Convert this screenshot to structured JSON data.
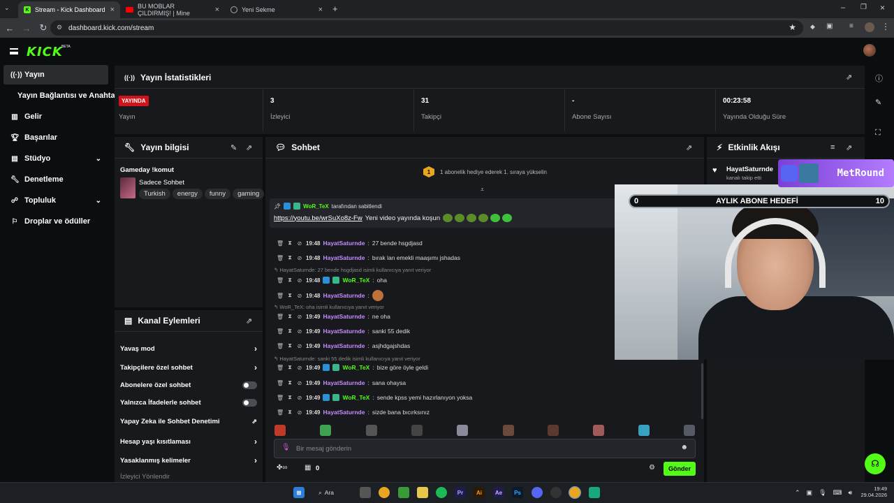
{
  "browser": {
    "tabs": [
      {
        "title": "Stream - Kick Dashboard"
      },
      {
        "title": "BU MOBLAR ÇILDIRMIŞ! | Mine"
      },
      {
        "title": "Yeni Sekme"
      }
    ],
    "url": "dashboard.kick.com/stream"
  },
  "header": {
    "logo": "KICK",
    "beta": "BETA"
  },
  "sidebar": {
    "items": [
      {
        "label": "Yayın"
      },
      {
        "label": "Yayın Bağlantısı ve Anahtarı"
      },
      {
        "label": "Gelir"
      },
      {
        "label": "Başarılar"
      },
      {
        "label": "Stüdyo"
      },
      {
        "label": "Denetleme"
      },
      {
        "label": "Topluluk"
      },
      {
        "label": "Droplar ve ödüller"
      }
    ]
  },
  "stats": {
    "title": "Yayın İstatistikleri",
    "live_badge": "YAYINDA",
    "items": [
      {
        "value": "",
        "label": "Yayın"
      },
      {
        "value": "3",
        "label": "İzleyici"
      },
      {
        "value": "31",
        "label": "Takipçi"
      },
      {
        "value": "-",
        "label": "Abone Sayısı"
      },
      {
        "value": "00:23:58",
        "label": "Yayında Olduğu Süre"
      }
    ]
  },
  "stream_info": {
    "title": "Yayın bilgisi",
    "stream_title": "Gameday !komut",
    "category": "Sadece Sohbet",
    "tags": [
      "Turkish",
      "energy",
      "funny",
      "gaming"
    ]
  },
  "channel_actions": {
    "title": "Kanal Eylemleri",
    "items": [
      {
        "label": "Yavaş mod"
      },
      {
        "label": "Takipçilere özel sohbet"
      },
      {
        "label": "Abonelere özel sohbet"
      },
      {
        "label": "Yalnızca İfadelerle sohbet"
      },
      {
        "label": "Yapay Zeka ile Sohbet Denetimi"
      },
      {
        "label": "Hesap yaşı kısıtlaması"
      },
      {
        "label": "Yasaklanmış kelimeler"
      },
      {
        "label": "İzleyici Yönlendir"
      }
    ]
  },
  "chat": {
    "title": "Sohbet",
    "gift_banner": "1 abonelik hediye ederek 1. sıraya yükselin",
    "gift_rank": "1",
    "pinned": {
      "by_user": "WoR_TeX",
      "by_suffix": "tarafından sabitlendi",
      "link": "https://youtu.be/wrSuXo8z-Fw",
      "text": "Yeni video yayında koşun"
    },
    "messages": [
      {
        "time": "19:48",
        "user": "HayatSaturnde",
        "text": "27 bende hsgdjasd"
      },
      {
        "time": "19:48",
        "user": "HayatSaturnde",
        "text": "bırak lan emekli maaşımı jshadas"
      },
      {
        "reply": "HayatSaturnde: 27 bende hsgdjasd isimli kullanıcıya yanıt veriyor"
      },
      {
        "time": "19:48",
        "user": "WoR_TeX",
        "text": "oha"
      },
      {
        "time": "19:48",
        "user": "HayatSaturnde",
        "text": ""
      },
      {
        "reply": "WoR_TeX: oha isimli kullanıcıya yanıt veriyor"
      },
      {
        "time": "19:49",
        "user": "HayatSaturnde",
        "text": "ne oha"
      },
      {
        "time": "19:49",
        "user": "HayatSaturnde",
        "text": "sanki 55 dedik"
      },
      {
        "time": "19:49",
        "user": "HayatSaturnde",
        "text": "asjhdgajshdas"
      },
      {
        "reply": "HayatSaturnde: sanki 55 dedik isimli kullanıcıya yanıt veriyor"
      },
      {
        "time": "19:49",
        "user": "WoR_TeX",
        "text": "bize göre öyle geldi"
      },
      {
        "time": "19:49",
        "user": "HayatSaturnde",
        "text": "sana ohaysa"
      },
      {
        "time": "19:49",
        "user": "WoR_TeX",
        "text": "sende kpss yemi hazırlanıyon yoksa"
      },
      {
        "time": "19:49",
        "user": "HayatSaturnde",
        "text": "sizde bana bıcırksınız"
      }
    ],
    "input_placeholder": "Bir mesaj gönderin",
    "points": "0",
    "send_label": "Gönder"
  },
  "activity": {
    "title": "Etkinlik Akışı",
    "event_user": "HayatSaturnde",
    "event_text": "kanalı takip etti"
  },
  "overlay": {
    "goal_left": "0",
    "goal_title": "AYLIK ABONE HEDEFİ",
    "goal_right": "10",
    "discord_name": "MetRound"
  },
  "taskbar": {
    "search": "Ara",
    "time": "19:49",
    "date": "29.04.2026"
  },
  "colors": {
    "accent": "#53fc18",
    "live": "#d1131c",
    "username_purple": "#c58cff"
  }
}
